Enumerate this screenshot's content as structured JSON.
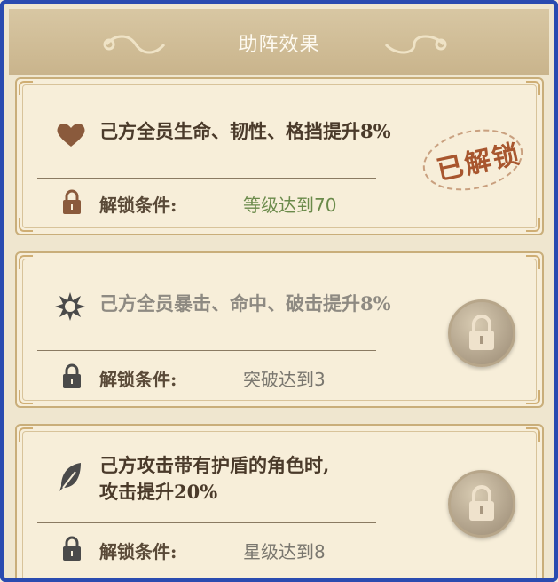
{
  "header": {
    "title": "助阵效果"
  },
  "cards": [
    {
      "effect": "己方全员生命、韧性、格挡提升8%",
      "condition_label": "解锁条件:",
      "condition_value": "等级达到70",
      "status": "已解锁",
      "icon": "heart-icon"
    },
    {
      "effect": "己方全员暴击、命中、破击提升8%",
      "condition_label": "解锁条件:",
      "condition_value": "突破达到3",
      "status": "locked",
      "icon": "burst-icon"
    },
    {
      "effect_line1": "己方攻击带有护盾的角色时,",
      "effect_line2": "攻击提升20%",
      "condition_label": "解锁条件:",
      "condition_value": "星级达到8",
      "status": "locked",
      "icon": "feather-icon"
    }
  ],
  "colors": {
    "frame_border": "#2a4bb0",
    "active_text": "#4a3a2a",
    "dim_text": "#8e8a82",
    "condition_met": "#6a8a4a",
    "stamp": "#a8562e"
  }
}
